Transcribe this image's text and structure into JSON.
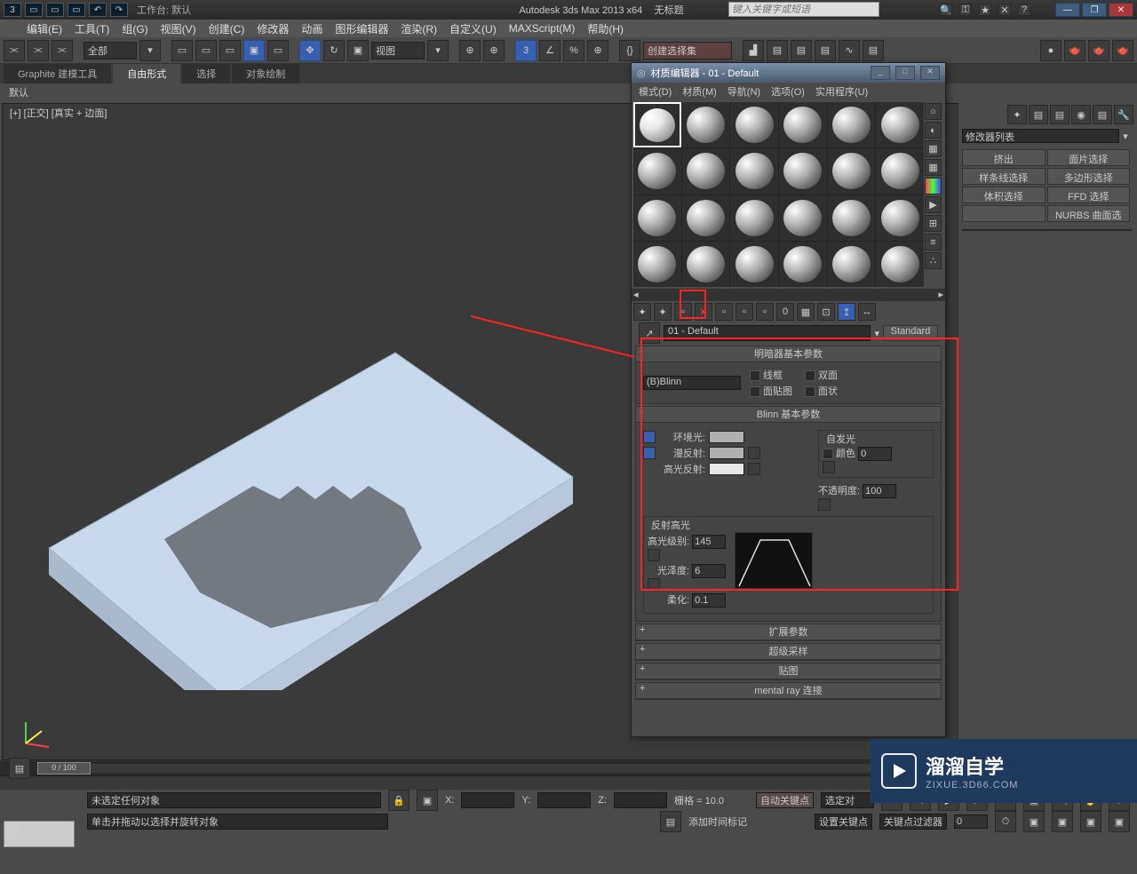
{
  "title": {
    "app": "Autodesk 3ds Max  2013 x64",
    "doc": "无标题",
    "workspace": "工作台: 默认",
    "search_ph": "键入关键字或短语"
  },
  "menu": [
    "编辑(E)",
    "工具(T)",
    "组(G)",
    "视图(V)",
    "创建(C)",
    "修改器",
    "动画",
    "图形编辑器",
    "渲染(R)",
    "自定义(U)",
    "MAXScript(M)",
    "帮助(H)"
  ],
  "toolbar": {
    "all": "全部",
    "view": "视图",
    "selset": "创建选择集"
  },
  "ribbon": {
    "tabs": [
      "Graphite 建模工具",
      "自由形式",
      "选择",
      "对象绘制"
    ],
    "sub": "默认"
  },
  "viewport": {
    "label": "[+] [正交] [真实 + 边面]"
  },
  "rp": {
    "mod": "修改器列表",
    "btns": [
      "挤出",
      "面片选择",
      "样条线选择",
      "多边形选择",
      "体积选择",
      "FFD 选择",
      "",
      "NURBS 曲面选"
    ]
  },
  "timeline": {
    "pos": "0 / 100"
  },
  "status": {
    "l1": "未选定任何对象",
    "l2": "单击并拖动以选择并旋转对象",
    "x": "X:",
    "y": "Y:",
    "z": "Z:",
    "grid": "栅格 = 10.0",
    "autokey": "自动关键点",
    "selkey": "选定对",
    "setkey": "设置关键点",
    "keyfilter": "关键点过滤器",
    "addtime": "添加时间标记"
  },
  "welcome": {
    "l1": "欢迎使用",
    "l2": "MAXScr"
  },
  "matdlg": {
    "title": "材质编辑器 - 01 - Default",
    "menu": [
      "模式(D)",
      "材质(M)",
      "导航(N)",
      "选项(O)",
      "实用程序(U)"
    ],
    "name": "01 - Default",
    "type": "Standard",
    "shader": {
      "title": "明暗器基本参数",
      "sel": "(B)Blinn",
      "wire": "线框",
      "double": "双面",
      "facemap": "面贴图",
      "faceted": "面状"
    },
    "blinn": {
      "title": "Blinn 基本参数",
      "ambient": "环境光:",
      "diffuse": "漫反射:",
      "specular": "高光反射:",
      "selfillum": "自发光",
      "color": "颜色",
      "c_val": "0",
      "opacity": "不透明度:",
      "o_val": "100",
      "spechl": "反射高光",
      "level": "高光级别:",
      "l_val": "145",
      "gloss": "光泽度:",
      "g_val": "6",
      "soften": "柔化:",
      "s_val": "0.1"
    },
    "rolls": [
      "扩展参数",
      "超级采样",
      "贴图",
      "mental ray 连接"
    ]
  },
  "watermark": {
    "cn": "溜溜自学",
    "en": "ZIXUE.3D66.COM"
  }
}
